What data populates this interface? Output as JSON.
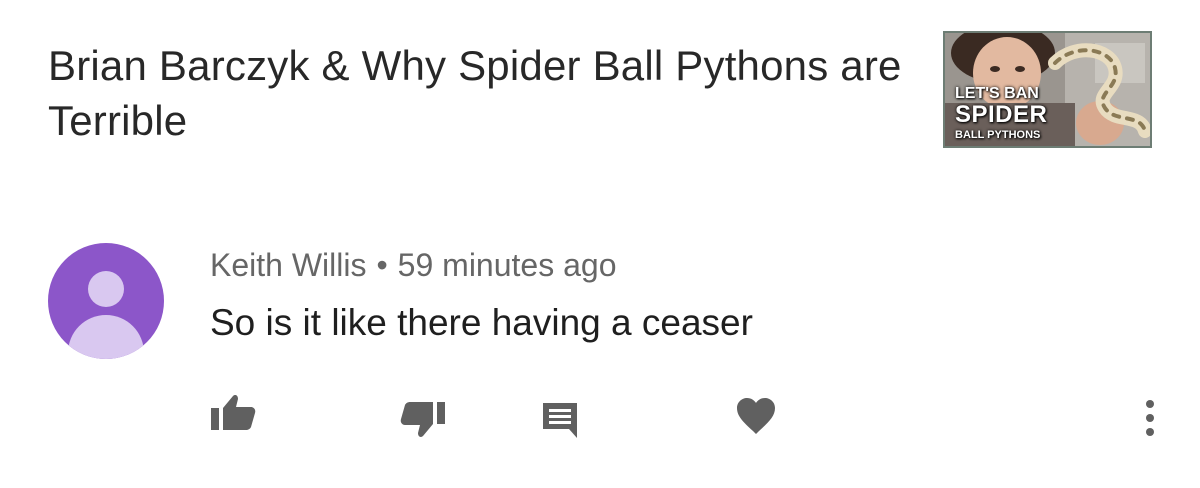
{
  "video": {
    "title": "Brian Barczyk & Why Spider Ball Pythons are Terrible",
    "thumbnail": {
      "line1": "LET'S BAN",
      "line2": "SPIDER",
      "line3": "BALL PYTHONS"
    }
  },
  "comment": {
    "author": "Keith Willis",
    "separator": "•",
    "time": "59 minutes ago",
    "text": "So is it like there having a ceaser",
    "avatar_color": "#8c56c9"
  },
  "actions": {
    "icon_color": "#606060",
    "like_icon": "thumbs-up-icon",
    "dislike_icon": "thumbs-down-icon",
    "reply_icon": "reply-comment-icon",
    "heart_icon": "heart-icon",
    "more_icon": "more-vertical-icon"
  }
}
